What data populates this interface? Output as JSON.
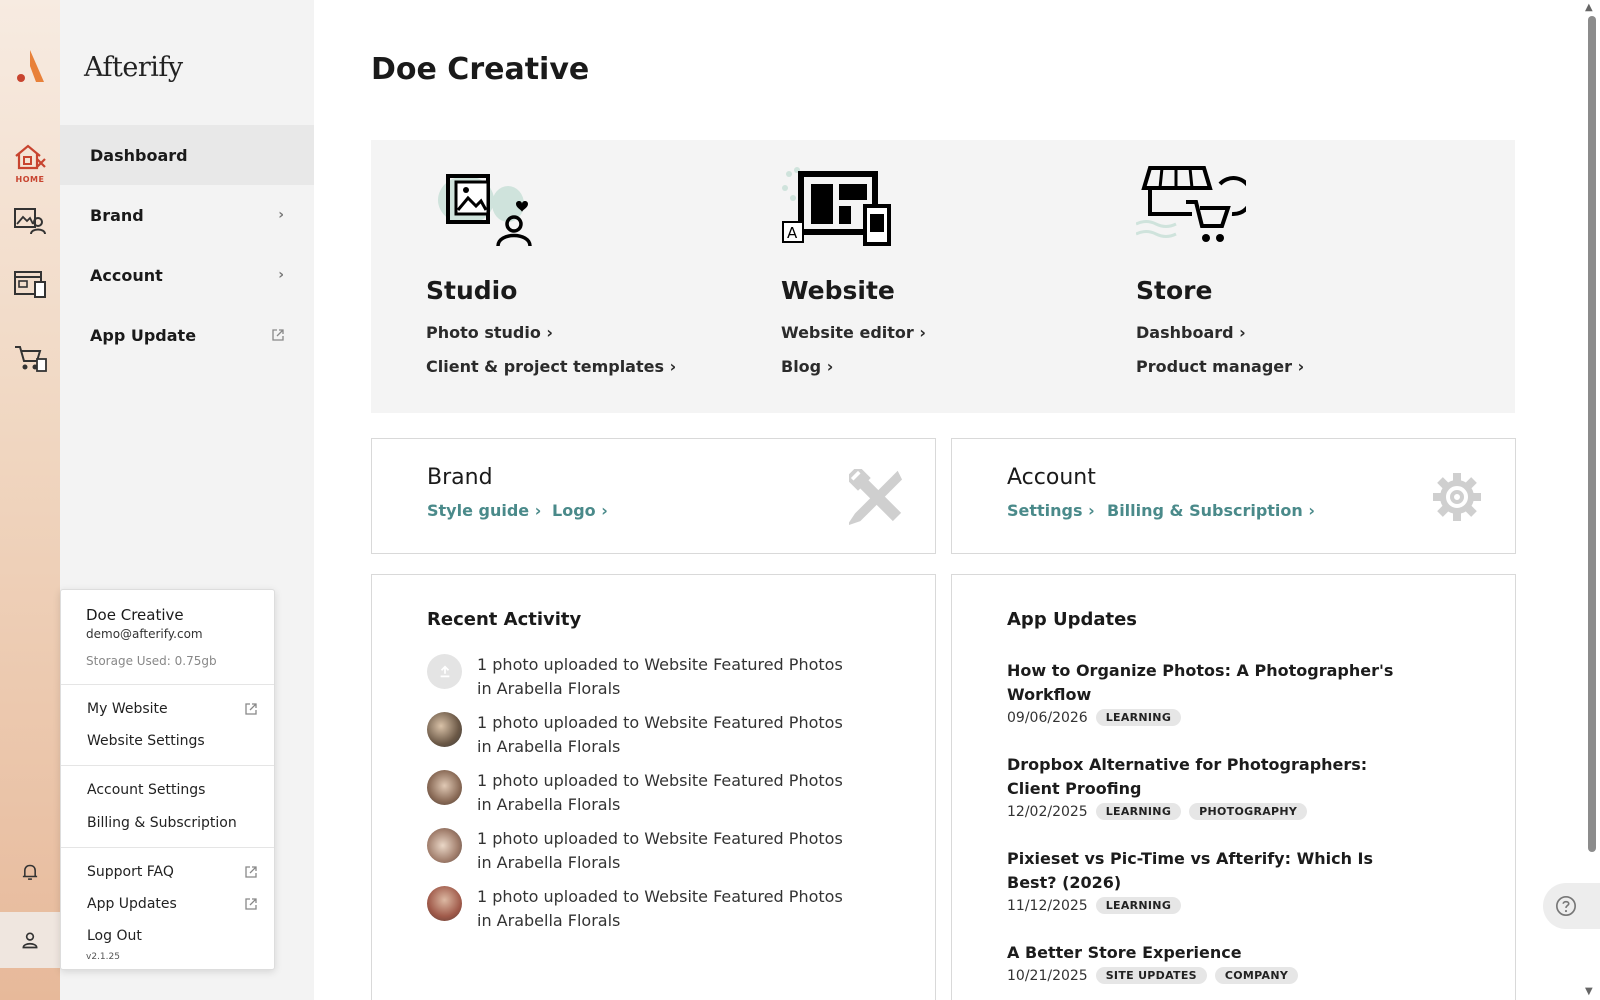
{
  "app": {
    "logo_text": "Afterify"
  },
  "rail": {
    "home_caption": "HOME"
  },
  "sidebar": {
    "items": [
      {
        "label": "Dashboard"
      },
      {
        "label": "Brand"
      },
      {
        "label": "Account"
      },
      {
        "label": "App Update"
      }
    ]
  },
  "popup": {
    "name": "Doe Creative",
    "email": "demo@afterify.com",
    "storage": "Storage Used: 0.75gb",
    "my_website": "My Website",
    "website_settings": "Website Settings",
    "account_settings": "Account Settings",
    "billing": "Billing & Subscription",
    "support_faq": "Support FAQ",
    "app_updates": "App Updates",
    "log_out": "Log Out",
    "version": "v2.1.25"
  },
  "main": {
    "title": "Doe Creative",
    "hero": [
      {
        "title": "Studio",
        "links": [
          "Photo studio",
          "Client & project templates"
        ]
      },
      {
        "title": "Website",
        "links": [
          "Website editor",
          "Blog"
        ]
      },
      {
        "title": "Store",
        "links": [
          "Dashboard",
          "Product manager"
        ]
      }
    ],
    "brand_card": {
      "title": "Brand",
      "links": [
        "Style guide",
        "Logo"
      ]
    },
    "account_card": {
      "title": "Account",
      "links": [
        "Settings",
        "Billing & Subscription"
      ]
    },
    "recent": {
      "title": "Recent Activity",
      "items": [
        {
          "line1": "1 photo uploaded to Website Featured Photos",
          "line2": "in Arabella Florals"
        },
        {
          "line1": "1 photo uploaded to Website Featured Photos",
          "line2": "in Arabella Florals"
        },
        {
          "line1": "1 photo uploaded to Website Featured Photos",
          "line2": "in Arabella Florals"
        },
        {
          "line1": "1 photo uploaded to Website Featured Photos",
          "line2": "in Arabella Florals"
        },
        {
          "line1": "1 photo uploaded to Website Featured Photos",
          "line2": "in Arabella Florals"
        }
      ]
    },
    "updates": {
      "title": "App Updates",
      "items": [
        {
          "title": "How to Organize Photos: A Photographer's Workflow",
          "date": "09/06/2026",
          "tags": [
            "LEARNING"
          ]
        },
        {
          "title": "Dropbox Alternative for Photographers: Client Proofing",
          "date": "12/02/2025",
          "tags": [
            "LEARNING",
            "PHOTOGRAPHY"
          ]
        },
        {
          "title": "Pixieset vs Pic-Time vs Afterify: Which Is Best? (2026)",
          "date": "11/12/2025",
          "tags": [
            "LEARNING"
          ]
        },
        {
          "title": "A Better Store Experience",
          "date": "10/21/2025",
          "tags": [
            "SITE UPDATES",
            "COMPANY"
          ]
        }
      ]
    }
  },
  "colors": {
    "accent": "#c8442f",
    "link": "#4a8a8a",
    "sidebar_bg": "#f3f3f3",
    "hero_bg": "#f4f4f4"
  },
  "icons": [
    "afterify-logo-icon",
    "home-icon",
    "studio-icon",
    "website-icon",
    "store-icon",
    "bell-icon",
    "user-icon",
    "chevron-right-icon",
    "external-link-icon",
    "wrench-icon",
    "gear-icon",
    "upload-icon",
    "help-icon"
  ]
}
